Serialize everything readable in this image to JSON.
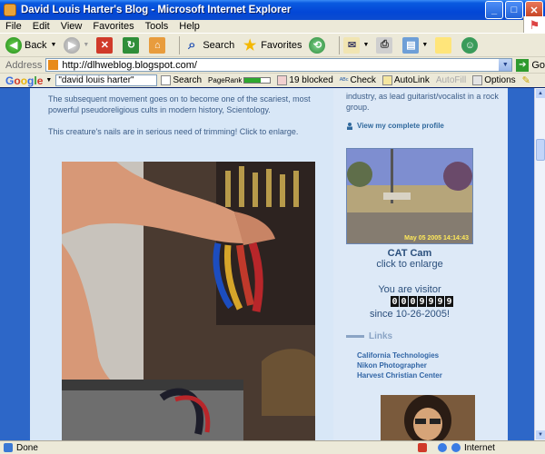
{
  "window": {
    "title": "David Louis Harter's Blog - Microsoft Internet Explorer",
    "min_label": "_",
    "max_label": "□",
    "close_label": "✕"
  },
  "menu": {
    "items": [
      "File",
      "Edit",
      "View",
      "Favorites",
      "Tools",
      "Help"
    ]
  },
  "toolbar": {
    "back_label": "Back",
    "search_label": "Search",
    "favorites_label": "Favorites"
  },
  "address": {
    "label": "Address",
    "url": "http://dlhweblog.blogspot.com/",
    "go_label": "Go"
  },
  "google": {
    "logo": "Google",
    "query": "\"david louis harter\"",
    "search_label": "Search",
    "pagerank_label": "PageRank",
    "pagerank_fill": 0.65,
    "blocked_label": "19 blocked",
    "check_label": "Check",
    "autolink_label": "AutoLink",
    "autofill_label": "AutoFill",
    "options_label": "Options"
  },
  "post": {
    "paragraph1": "The subsequent movement goes on to become one of the scariest, most powerful pseudoreligious cults in modern history, Scientology.",
    "paragraph2": "This creature's nails are in serious need of trimming! Click to enlarge."
  },
  "sidebar": {
    "intro": "industry, as lead guitarist/vocalist in a rock group.",
    "profile_link": "View my complete profile",
    "cam_stamp": "May 05 2005 14:14:43",
    "cam_title": "CAT Cam",
    "cam_sub": "click to enlarge",
    "visitor_text": "You are visitor",
    "counter_digits": [
      "0",
      "0",
      "0",
      "9",
      "9",
      "9",
      "9"
    ],
    "since_text": "since 10-26-2005!",
    "links_heading": "Links",
    "links": [
      "California Technologies",
      "Nikon Photographer",
      "Harvest Christian Center"
    ]
  },
  "status": {
    "done": "Done",
    "zone": "Internet"
  }
}
